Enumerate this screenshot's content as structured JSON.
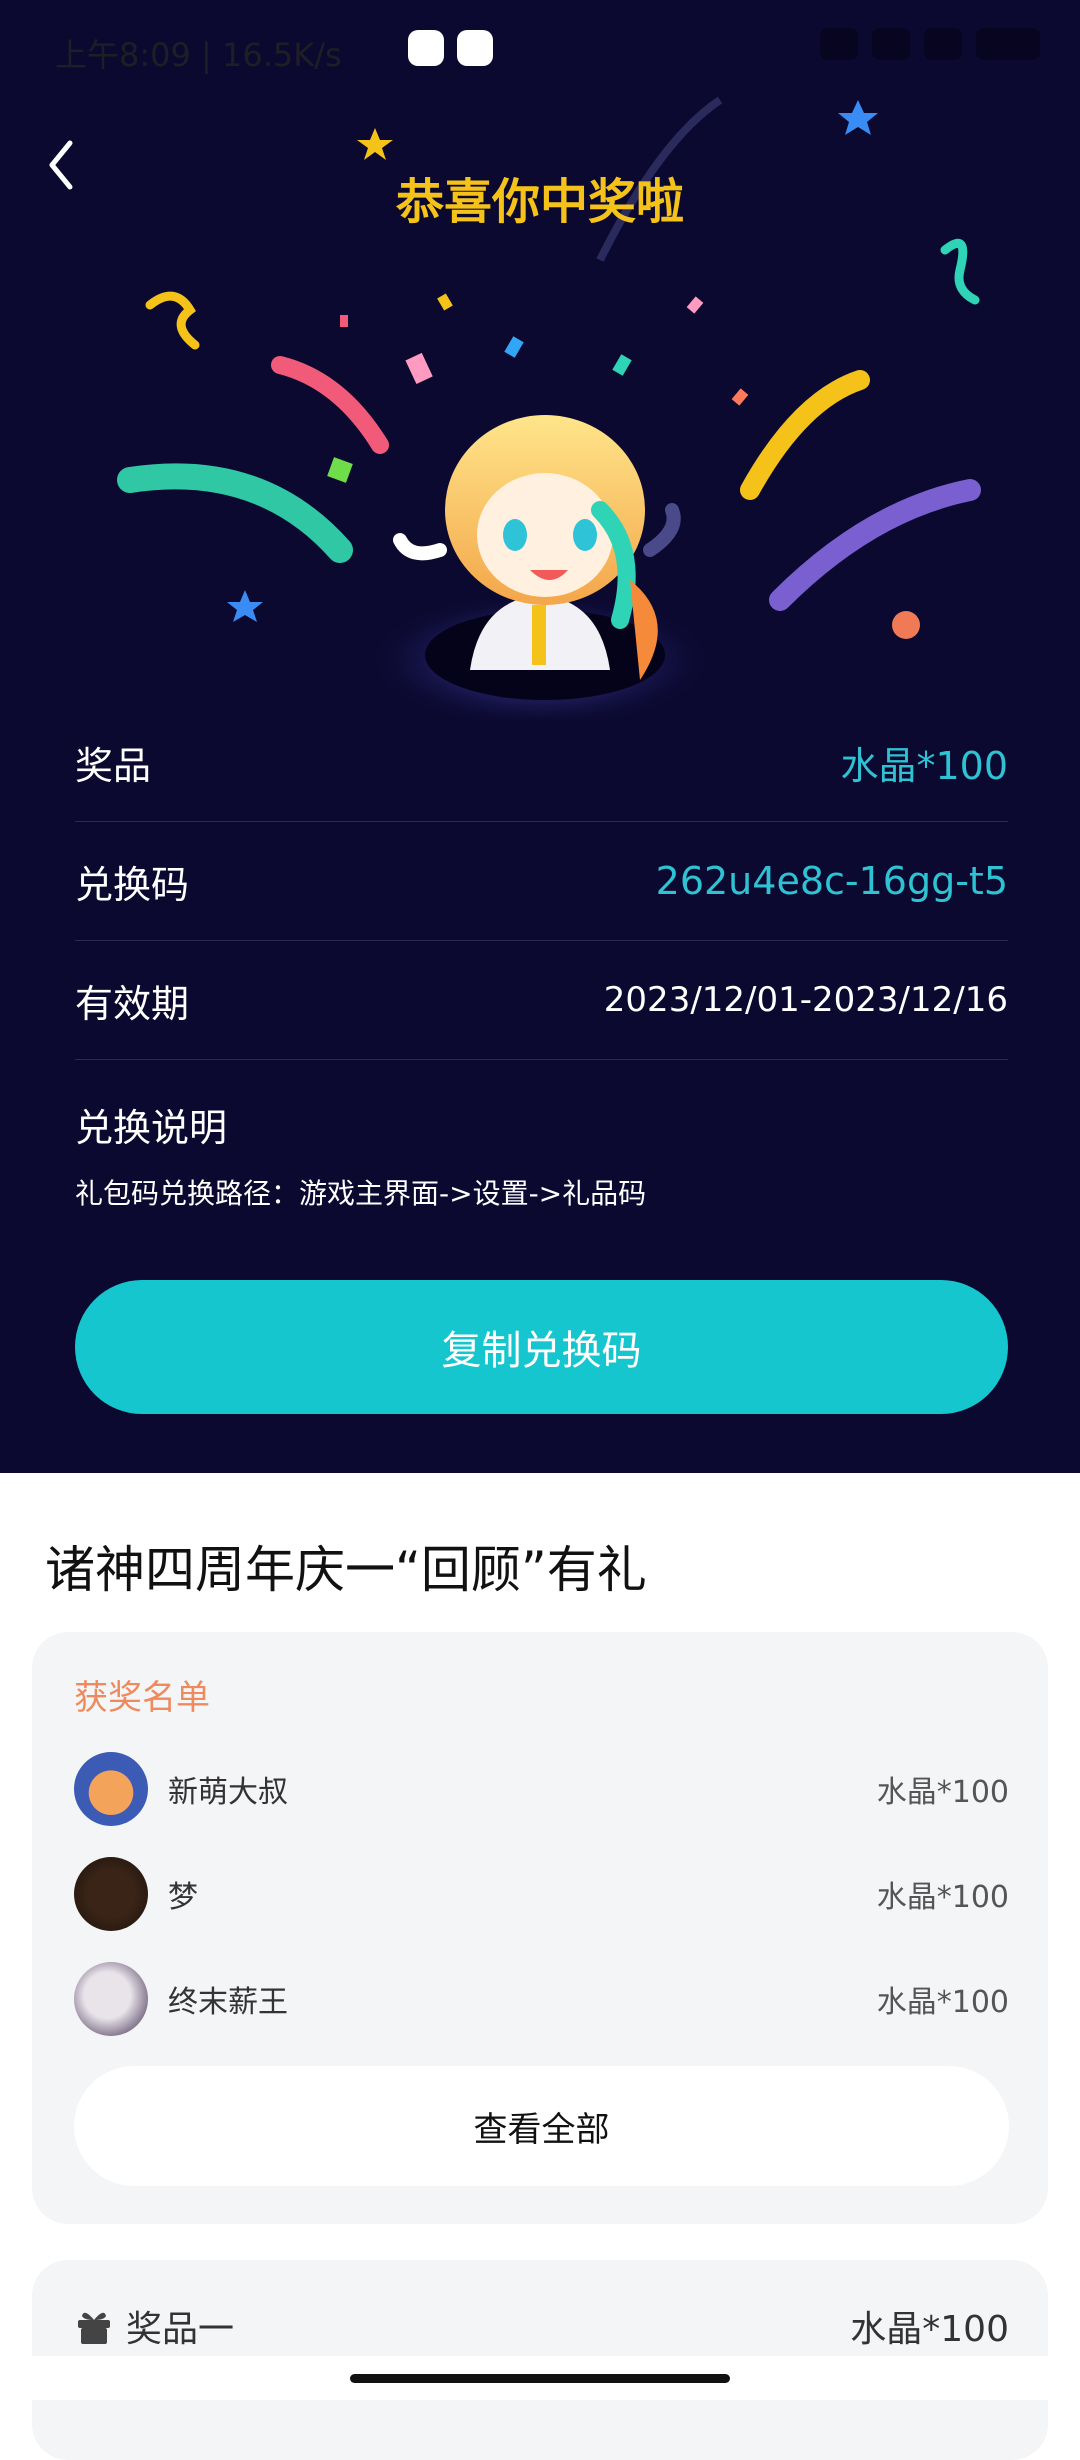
{
  "status_bar": {
    "time_and_speed": "上午8:09 | 16.5K/s"
  },
  "header": {
    "title": "恭喜你中奖啦"
  },
  "prize_info": {
    "prize_label": "奖品",
    "prize_value": "水晶*100",
    "code_label": "兑换码",
    "code_value": "262u4e8c-16gg-t5",
    "validity_label": "有效期",
    "validity_value": "2023/12/01-2023/12/16",
    "instructions_title": "兑换说明",
    "instructions_text": "礼包码兑换路径：游戏主界面->设置->礼品码",
    "copy_button_label": "复制兑换码"
  },
  "event": {
    "title": "诸神四周年庆一“回顾”有礼"
  },
  "winners_card": {
    "title": "获奖名单",
    "winners": [
      {
        "name": "新萌大叔",
        "prize": "水晶*100"
      },
      {
        "name": "梦",
        "prize": "水晶*100"
      },
      {
        "name": "终末薪王",
        "prize": "水晶*100"
      }
    ],
    "view_all_label": "查看全部"
  },
  "prize_list": {
    "item_label": "奖品一",
    "item_value": "水晶*100"
  },
  "colors": {
    "bg_dark": "#0b0930",
    "accent_cyan": "#16c6cf",
    "title_gold": "#f5c21a",
    "winner_title": "#ef8a5e"
  }
}
